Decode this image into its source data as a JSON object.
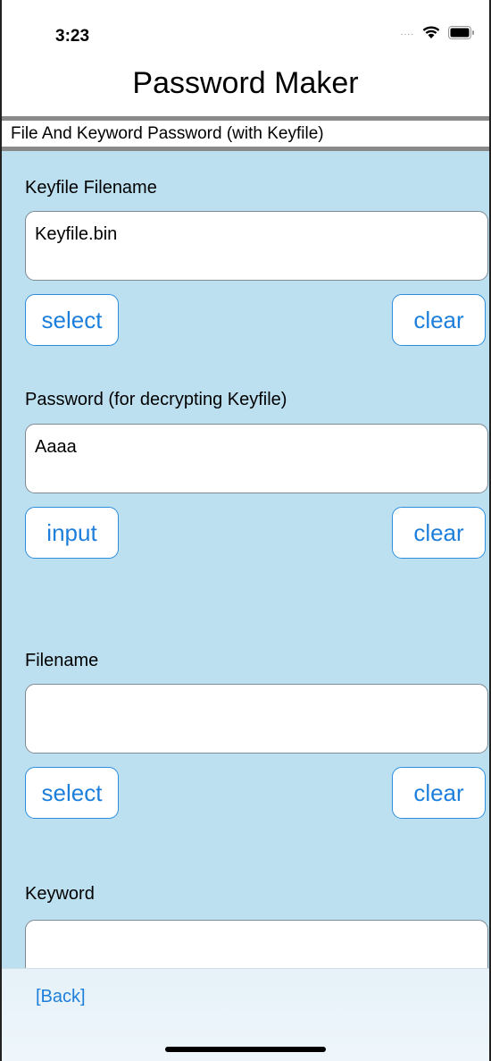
{
  "status_bar": {
    "time": "3:23",
    "signal": "....",
    "wifi_icon": "wifi-icon",
    "battery_icon": "battery-icon"
  },
  "header": {
    "title": "Password Maker",
    "subtitle": "File And Keyword Password (with Keyfile)"
  },
  "sections": {
    "keyfile": {
      "label": "Keyfile Filename",
      "value": "Keyfile.bin",
      "left_button": "select",
      "right_button": "clear"
    },
    "password": {
      "label": "Password (for decrypting Keyfile)",
      "value": "Aaaa",
      "left_button": "input",
      "right_button": "clear"
    },
    "filename": {
      "label": "Filename",
      "value": "",
      "left_button": "select",
      "right_button": "clear"
    },
    "keyword": {
      "label": "Keyword",
      "value": ""
    }
  },
  "footer": {
    "back_label": "[Back]"
  },
  "colors": {
    "accent": "#1d7fdb",
    "content_bg": "#bde0f1",
    "divider": "#8a8a8a"
  }
}
